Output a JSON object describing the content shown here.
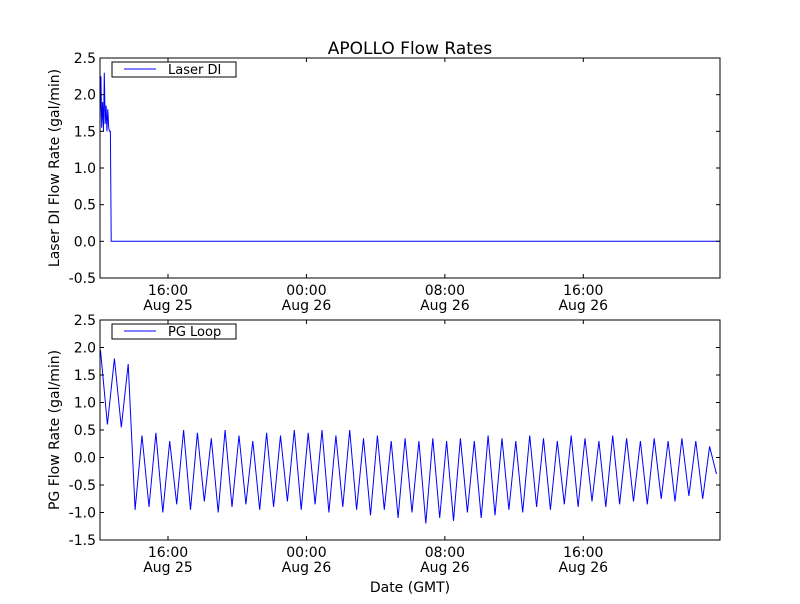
{
  "chart_data": [
    {
      "type": "line",
      "title": "APOLLO Flow Rates",
      "xlabel": "",
      "ylabel": "Laser DI Flow Rate (gal/min)",
      "ylim": [
        -0.5,
        2.5
      ],
      "yticks": [
        "-0.5",
        "0.0",
        "0.5",
        "1.0",
        "1.5",
        "2.0",
        "2.5"
      ],
      "x_units": "hours since Aug 25 00:00 GMT",
      "xlim": [
        12.07,
        47.9
      ],
      "xticks": [
        {
          "x": 16,
          "time": "16:00",
          "date": "Aug 25"
        },
        {
          "x": 24,
          "time": "00:00",
          "date": "Aug 26"
        },
        {
          "x": 32,
          "time": "08:00",
          "date": "Aug 26"
        },
        {
          "x": 40,
          "time": "16:00",
          "date": "Aug 26"
        }
      ],
      "legend": {
        "position": "top-left",
        "entries": [
          "Laser DI"
        ]
      },
      "series": [
        {
          "name": "Laser DI",
          "color": "#0000ff",
          "x": [
            12.07,
            12.12,
            12.17,
            12.22,
            12.27,
            12.32,
            12.37,
            12.42,
            12.47,
            12.52,
            12.57,
            12.62,
            12.67,
            12.72,
            47.9
          ],
          "y": [
            1.6,
            2.25,
            1.55,
            1.9,
            1.5,
            2.3,
            1.6,
            1.85,
            1.5,
            1.8,
            1.55,
            1.5,
            1.5,
            0,
            0
          ]
        }
      ]
    },
    {
      "type": "line",
      "title": "",
      "xlabel": "Date (GMT)",
      "ylabel": "PG Flow Rate (gal/min)",
      "ylim": [
        -1.5,
        2.5
      ],
      "yticks": [
        "-1.5",
        "-1.0",
        "-0.5",
        "0.0",
        "0.5",
        "1.0",
        "1.5",
        "2.0",
        "2.5"
      ],
      "x_units": "hours since Aug 25 00:00 GMT",
      "xlim": [
        12.07,
        47.9
      ],
      "xticks": [
        {
          "x": 16,
          "time": "16:00",
          "date": "Aug 25"
        },
        {
          "x": 24,
          "time": "00:00",
          "date": "Aug 26"
        },
        {
          "x": 32,
          "time": "08:00",
          "date": "Aug 26"
        },
        {
          "x": 40,
          "time": "16:00",
          "date": "Aug 26"
        }
      ],
      "legend": {
        "position": "top-left",
        "entries": [
          "PG Loop"
        ]
      },
      "series": [
        {
          "name": "PG Loop",
          "color": "#0000ff",
          "x_start": 12.1,
          "x_step": 0.4,
          "y": [
            1.95,
            0.6,
            1.8,
            0.55,
            1.7,
            -0.95,
            0.4,
            -0.9,
            0.45,
            -1.0,
            0.3,
            -0.85,
            0.5,
            -0.95,
            0.45,
            -0.8,
            0.35,
            -1.0,
            0.5,
            -0.9,
            0.4,
            -0.85,
            0.3,
            -0.95,
            0.45,
            -0.9,
            0.4,
            -0.8,
            0.5,
            -0.95,
            0.45,
            -0.85,
            0.5,
            -1.0,
            0.4,
            -0.9,
            0.5,
            -0.95,
            0.35,
            -1.05,
            0.4,
            -0.95,
            0.3,
            -1.1,
            0.35,
            -1.0,
            0.3,
            -1.2,
            0.35,
            -1.1,
            0.3,
            -1.15,
            0.35,
            -1.0,
            0.3,
            -1.1,
            0.4,
            -1.05,
            0.35,
            -0.95,
            0.3,
            -1.0,
            0.4,
            -0.9,
            0.35,
            -0.95,
            0.3,
            -0.85,
            0.4,
            -0.9,
            0.35,
            -0.8,
            0.3,
            -0.9,
            0.4,
            -0.85,
            0.35,
            -0.8,
            0.3,
            -0.85,
            0.35,
            -0.75,
            0.3,
            -0.8,
            0.35,
            -0.7,
            0.3,
            -0.75,
            0.2,
            -0.3
          ]
        }
      ]
    }
  ]
}
